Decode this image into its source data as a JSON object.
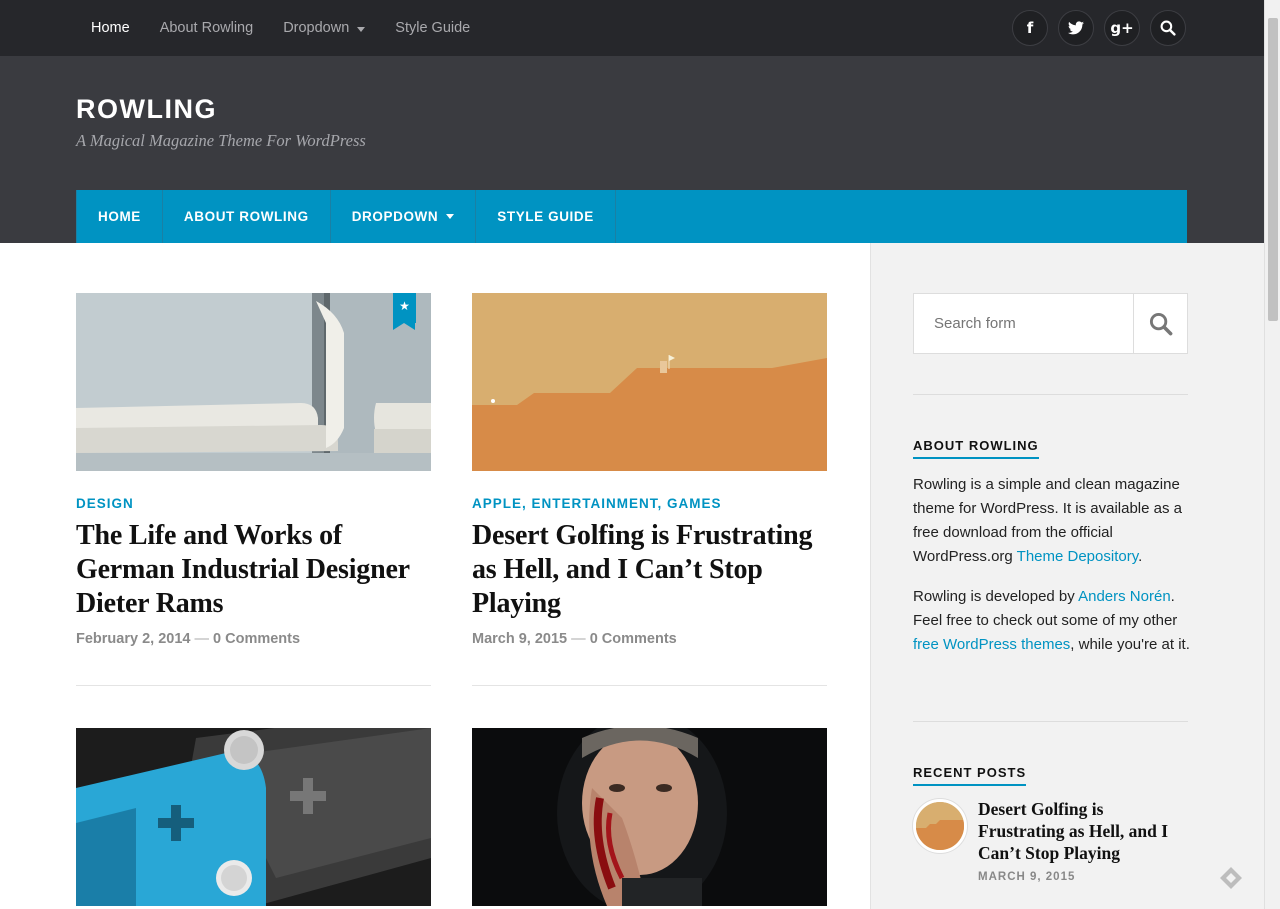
{
  "topnav": {
    "items": [
      {
        "label": "Home"
      },
      {
        "label": "About Rowling"
      },
      {
        "label": "Dropdown"
      },
      {
        "label": "Style Guide"
      }
    ]
  },
  "social": {
    "facebook": "f",
    "twitter": "t",
    "googleplus": "g+",
    "icons": [
      "facebook-icon",
      "twitter-icon",
      "google-plus-icon",
      "search-icon"
    ]
  },
  "header": {
    "title": "ROWLING",
    "description": "A Magical Magazine Theme For WordPress"
  },
  "mainnav": {
    "items": [
      {
        "label": "HOME"
      },
      {
        "label": "ABOUT ROWLING"
      },
      {
        "label": "DROPDOWN"
      },
      {
        "label": "STYLE GUIDE"
      }
    ]
  },
  "posts": [
    {
      "category": "DESIGN",
      "title": "The Life and Works of German Industrial Designer Dieter Rams",
      "date": "February 2, 2014",
      "separator": "—",
      "comments": "0 Comments",
      "sticky": true
    },
    {
      "category": "APPLE, ENTERTAINMENT, GAMES",
      "title": "Desert Golfing is Frustrating as Hell, and I Can’t Stop Playing",
      "date": "March 9, 2015",
      "separator": "—",
      "comments": "0 Comments"
    }
  ],
  "sidebar": {
    "search_placeholder": "Search form",
    "about": {
      "title": "ABOUT ROWLING",
      "p1_text": "Rowling is a simple and clean magazine theme for WordPress. It is available as a free download from the official WordPress.org ",
      "p1_link": "Theme Depository",
      "p1_end": ".",
      "p2_text": "Rowling is developed by ",
      "p2_link1": "Anders Norén",
      "p2_mid": ". Feel free to check out some of my other ",
      "p2_link2": "free WordPress themes",
      "p2_end": ", while you're at it."
    },
    "recent": {
      "title": "RECENT POSTS",
      "items": [
        {
          "title": "Desert Golfing is Frustrating as Hell, and I Can’t Stop Playing",
          "date": "MARCH 9, 2015"
        }
      ]
    }
  },
  "colors": {
    "accent": "#0093c2",
    "topbar": "#26272b",
    "header": "#3a3b40"
  }
}
